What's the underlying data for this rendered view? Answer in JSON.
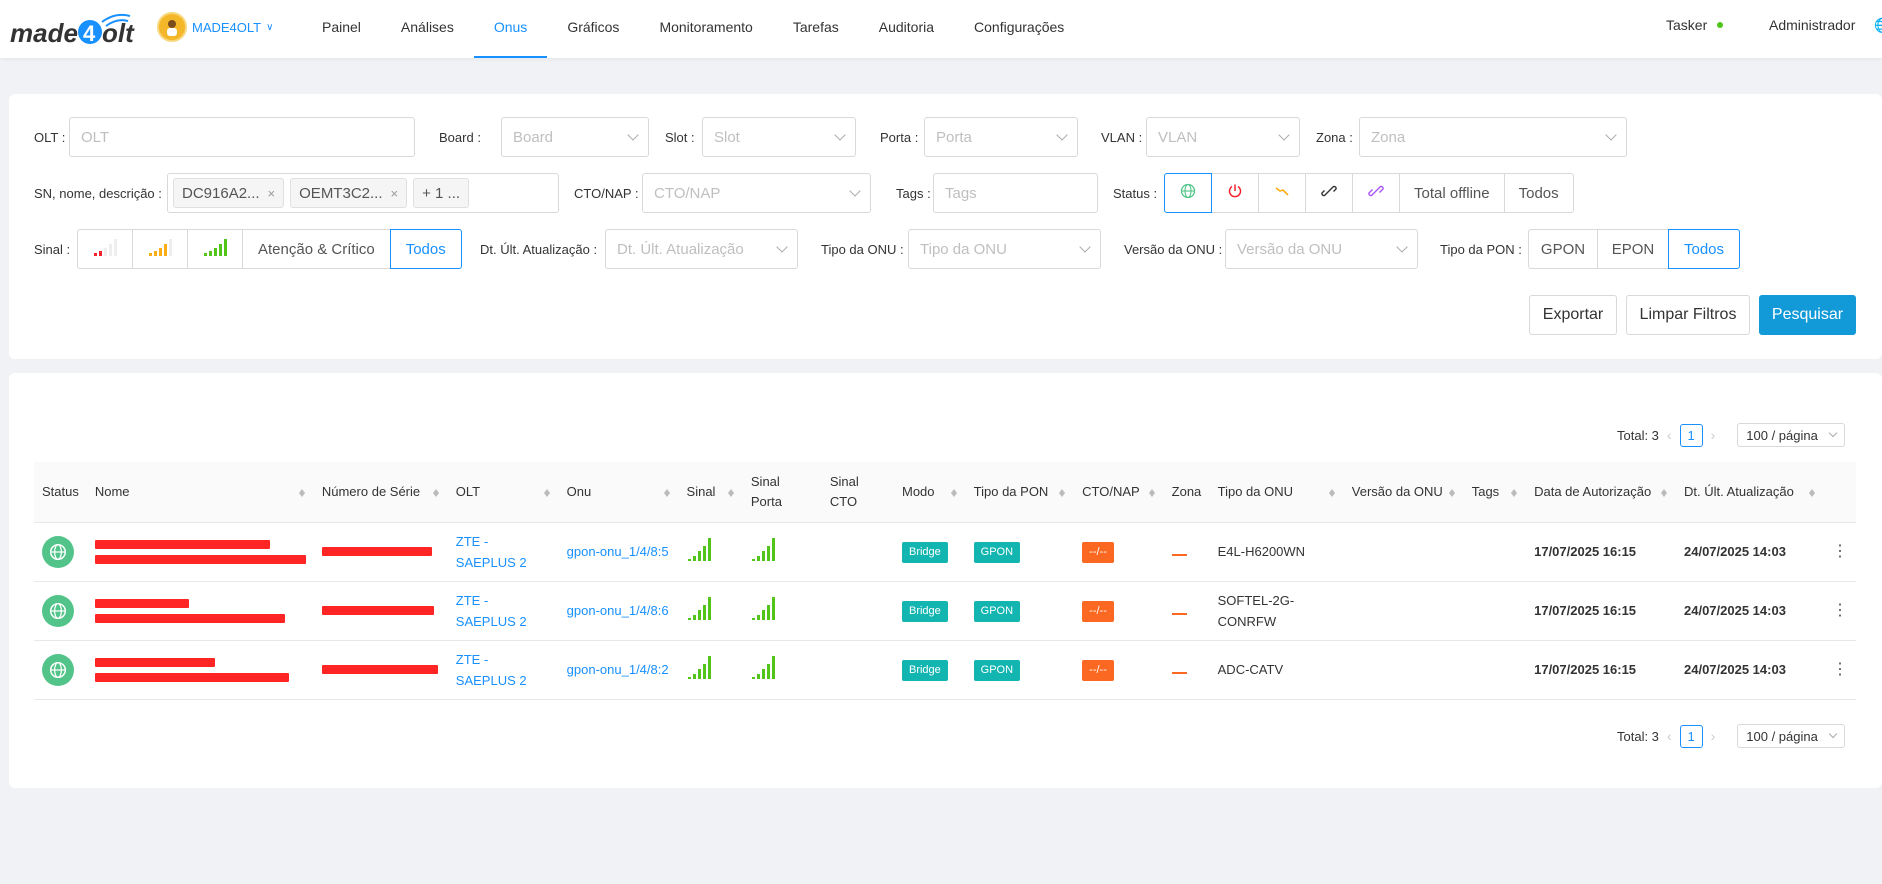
{
  "nav": {
    "brand": "MADE4OLT",
    "logo_text": "made4olt",
    "menu": [
      "Painel",
      "Análises",
      "Onus",
      "Gráficos",
      "Monitoramento",
      "Tarefas",
      "Auditoria",
      "Configurações"
    ],
    "active": "Onus",
    "tasker": "Tasker",
    "user": "Administrador"
  },
  "filters": {
    "olt": {
      "label": "OLT",
      "placeholder": "OLT"
    },
    "board": {
      "label": "Board",
      "placeholder": "Board"
    },
    "slot": {
      "label": "Slot",
      "placeholder": "Slot"
    },
    "porta": {
      "label": "Porta",
      "placeholder": "Porta"
    },
    "vlan": {
      "label": "VLAN",
      "placeholder": "VLAN"
    },
    "zona": {
      "label": "Zona",
      "placeholder": "Zona"
    },
    "sn": {
      "label": "SN, nome, descrição",
      "tags": [
        "DC916A2...",
        "OEMT3C2..."
      ],
      "more": "+ 1 ..."
    },
    "cto": {
      "label": "CTO/NAP",
      "placeholder": "CTO/NAP"
    },
    "tags": {
      "label": "Tags",
      "placeholder": "Tags"
    },
    "status": {
      "label": "Status",
      "total_offline": "Total offline",
      "todos": "Todos"
    },
    "sinal": {
      "label": "Sinal",
      "atencao": "Atenção & Crítico",
      "todos": "Todos"
    },
    "dt_ult": {
      "label": "Dt. Últ. Atualização",
      "placeholder": "Dt. Últ. Atualização"
    },
    "tipo_onu": {
      "label": "Tipo da ONU",
      "placeholder": "Tipo da ONU"
    },
    "versao_onu": {
      "label": "Versão da ONU",
      "placeholder": "Versão da ONU"
    },
    "tipo_pon": {
      "label": "Tipo da PON",
      "options": [
        "GPON",
        "EPON",
        "Todos"
      ],
      "selected": "Todos"
    }
  },
  "actions": {
    "exportar": "Exportar",
    "limpar": "Limpar Filtros",
    "pesquisar": "Pesquisar"
  },
  "pagination": {
    "total": "Total: 3",
    "page": "1",
    "page_size": "100 / página"
  },
  "table": {
    "columns": [
      "Status",
      "Nome",
      "Número de Série",
      "OLT",
      "Onu",
      "Sinal",
      "Sinal Porta",
      "Sinal CTO",
      "Modo",
      "Tipo da PON",
      "CTO/NAP",
      "Zona",
      "Tipo da ONU",
      "Versão da ONU",
      "Tags",
      "Data de Autorização",
      "Dt. Últ. Atualização"
    ],
    "rows": [
      {
        "olt": "ZTE - SAEPLUS 2",
        "onu": "gpon-onu_1/4/8:5",
        "modo": "Bridge",
        "pon": "GPON",
        "cto": "--/--",
        "tipo_onu": "E4L-H6200WN",
        "autorizacao": "17/07/2025 16:15",
        "atualizacao": "24/07/2025 14:03"
      },
      {
        "olt": "ZTE - SAEPLUS 2",
        "onu": "gpon-onu_1/4/8:6",
        "modo": "Bridge",
        "pon": "GPON",
        "cto": "--/--",
        "tipo_onu": "SOFTEL-2G-CONRFW",
        "autorizacao": "17/07/2025 16:15",
        "atualizacao": "24/07/2025 14:03"
      },
      {
        "olt": "ZTE - SAEPLUS 2",
        "onu": "gpon-onu_1/4/8:2",
        "modo": "Bridge",
        "pon": "GPON",
        "cto": "--/--",
        "tipo_onu": "ADC-CATV",
        "autorizacao": "17/07/2025 16:15",
        "atualizacao": "24/07/2025 14:03"
      }
    ]
  },
  "colors": {
    "primary": "#1890ff",
    "online": "#52c48a",
    "signal_good": "#52c41a",
    "orange": "#fa6821",
    "teal": "#13b5b1"
  }
}
